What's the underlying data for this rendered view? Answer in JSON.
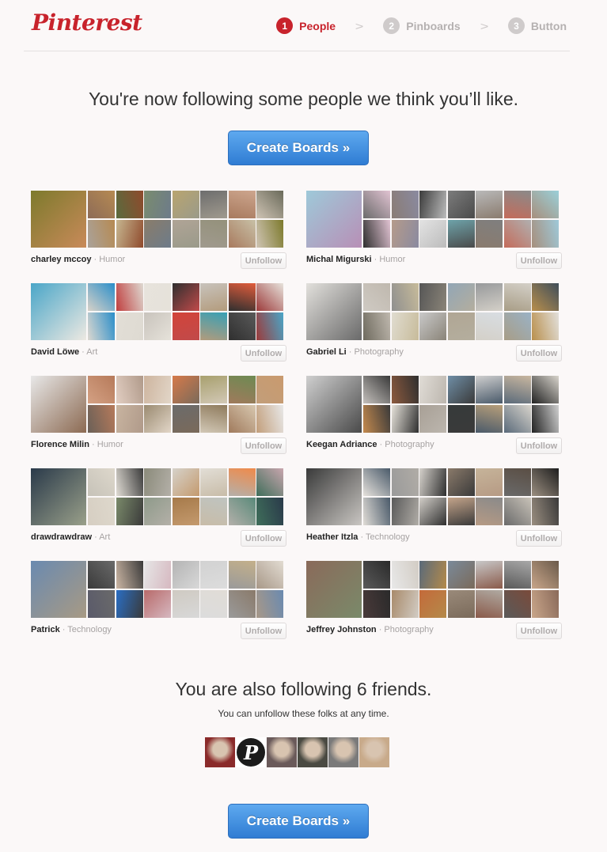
{
  "brand": "Pinterest",
  "steps": [
    {
      "number": "1",
      "label": "People",
      "active": true
    },
    {
      "number": "2",
      "label": "Pinboards",
      "active": false
    },
    {
      "number": "3",
      "label": "Button",
      "active": false
    }
  ],
  "headline": "You're now following some people we think you’ll like.",
  "create_boards_label": "Create Boards »",
  "unfollow_label": "Unfollow",
  "people": [
    {
      "name": "charley mccoy",
      "category": "Humor",
      "colors": [
        "#7d7a2c",
        "#c98a5a",
        "#8d6b57",
        "#5a6b3e",
        "#7a8c6e",
        "#b9a56f",
        "#6d6d6d",
        "#cda68e",
        "#6a6a5a",
        "#b68a52",
        "#8f4a2c",
        "#6d7b8a",
        "#9a9a8a",
        "#a09a8e",
        "#a87a5e",
        "#cfc4b4",
        "#aaa29a",
        "#c6b690",
        "#8a7d6a",
        "#b0a496",
        "#94917b",
        "#c8c1a7"
      ]
    },
    {
      "name": "Michal Migurski",
      "category": "Humor",
      "colors": [
        "#9ec9d9",
        "#b88fb6",
        "#6b6b6b",
        "#8a7c74",
        "#3c3c3c",
        "#7c7c7c",
        "#b9b9b9",
        "#8a8a8a",
        "#9ad0d9",
        "#e1c3d2",
        "#8a8aa0",
        "#bcbcbc",
        "#4a4a4a",
        "#8a7b6e",
        "#c46b5a",
        "#a78f7c",
        "#2f2f2f",
        "#b59b8a",
        "#e3e3e3",
        "#6ea3aa",
        "#7f7f7f",
        "#b0b0b0"
      ]
    },
    {
      "name": "David Löwe",
      "category": "Art",
      "colors": [
        "#4aa6c8",
        "#ede9e2",
        "#d8d2c8",
        "#c03e3e",
        "#e7e3dc",
        "#2f2f2f",
        "#c8c3bc",
        "#e25d3c",
        "#e7e3dc",
        "#2a8ec9",
        "#dedad2",
        "#e6e2da",
        "#c14a4a",
        "#b39b7c",
        "#2f2f2f",
        "#9c3a3a",
        "#dcd8d0",
        "#e2ded6",
        "#c8c3bc",
        "#d2443a",
        "#37a0b5",
        "#5a5a5a"
      ]
    },
    {
      "name": "Gabriel Li",
      "category": "Photography",
      "colors": [
        "#e2e0dc",
        "#6a6a6a",
        "#cfcac3",
        "#8f8f8f",
        "#565656",
        "#92a6b6",
        "#97999b",
        "#d4d0c8",
        "#3f4e5a",
        "#bfb8ae",
        "#c7bb9a",
        "#8a8478",
        "#b4ae9e",
        "#d4d0c8",
        "#a89d86",
        "#b98f4c",
        "#6e6a5e",
        "#e0dcd0",
        "#c9c9c9",
        "#b0a694",
        "#d8dde2",
        "#9ab2c6"
      ]
    },
    {
      "name": "Florence Milin",
      "category": "Humor",
      "colors": [
        "#e8e8e8",
        "#8c6a52",
        "#d4a184",
        "#e2cec2",
        "#cdb49e",
        "#d67a4a",
        "#a8a06e",
        "#6d8a52",
        "#c99a6e",
        "#b67a5a",
        "#b09a8a",
        "#e2d6c8",
        "#7a6a5a",
        "#d2c8b6",
        "#a07a5c",
        "#c29e7a",
        "#6a6058",
        "#c8b4a0",
        "#9a8a70",
        "#6b6b6b",
        "#8e7a5c",
        "#d8c8b0"
      ]
    },
    {
      "name": "Keegan Adriance",
      "category": "Photography",
      "colors": [
        "#cfcfcf",
        "#4a4a4a",
        "#c4c0bc",
        "#8c5a3e",
        "#e0dcd6",
        "#6f8ea6",
        "#cfcfcf",
        "#c9b7a0",
        "#d8d4cc",
        "#3a3a3a",
        "#2f2f2f",
        "#bcb6ae",
        "#3a3a3a",
        "#4a5a6a",
        "#5a6a7a",
        "#222222",
        "#c48a4e",
        "#e6e2da",
        "#a8a096",
        "#363a3a",
        "#b89f7a",
        "#d8d4cc"
      ]
    },
    {
      "name": "drawdrawdraw",
      "category": "Art",
      "colors": [
        "#2a3a4a",
        "#9aa08a",
        "#c6c2b8",
        "#e0dcd4",
        "#8a8a7a",
        "#d6d2ca",
        "#e2ded6",
        "#f08a4a",
        "#c9a6ae",
        "#ded8cc",
        "#3a3a3a",
        "#b4b0a8",
        "#c49a6e",
        "#c8bca8",
        "#b4b0aa",
        "#3f6e5a",
        "#d6cec2",
        "#7a8a6a",
        "#8e9a8a",
        "#a67a4a",
        "#bfc4c0",
        "#5a8a7a"
      ]
    },
    {
      "name": "Heather Itzla",
      "category": "Technology",
      "colors": [
        "#3a3a3a",
        "#c9c6c2",
        "#e6e2dc",
        "#9a9a9a",
        "#d6d2cc",
        "#8a7a6a",
        "#c6b49a",
        "#5a4e44",
        "#1e1e1e",
        "#4a5a6a",
        "#b0aca6",
        "#2f2f2f",
        "#3a3a3a",
        "#b69a84",
        "#6a6a6a",
        "#9a8e80",
        "#e0dcd6",
        "#5a5a5a",
        "#d2cec8",
        "#c4a48a",
        "#8a8a8a",
        "#c8c2b8"
      ]
    },
    {
      "name": "Patrick",
      "category": "Technology",
      "colors": [
        "#6a8ab0",
        "#a89a84",
        "#3a3a3a",
        "#cbb6a4",
        "#e6e6e6",
        "#b4b4b4",
        "#d2d2d2",
        "#c4b08a",
        "#e2dcd2",
        "#6a6a6a",
        "#3a3a3a",
        "#d6b8c0",
        "#d8d8d8",
        "#dcdcdc",
        "#9a9a9a",
        "#a89888",
        "#5a5a6a",
        "#2a6ec4",
        "#b86a6a",
        "#cfcac2",
        "#e0dcd6",
        "#8a7a6a"
      ]
    },
    {
      "name": "Jeffrey Johnston",
      "category": "Photography",
      "colors": [
        "#8a6a5a",
        "#7a8a6a",
        "#5a5a5a",
        "#e8e8e8",
        "#5a6a7a",
        "#7a8a9a",
        "#c8c8c8",
        "#a8a8a8",
        "#6a5a4a",
        "#2a2a2a",
        "#d2ccc4",
        "#b48a4a",
        "#7a6a5a",
        "#8a5a4a",
        "#5a5a5a",
        "#c9a68a",
        "#4a3a3a",
        "#a88a6a",
        "#c46a3a",
        "#9a8a7a",
        "#b0aaa2",
        "#7a4a3a"
      ]
    }
  ],
  "friends_title": "You are also following 6 friends.",
  "friends_subtitle": "You can unfollow these folks at any time.",
  "friends": [
    {
      "type": "photo",
      "color": "#8a2a2a"
    },
    {
      "type": "pinterest-logo",
      "letter": "P"
    },
    {
      "type": "photo",
      "color": "#6a5a5a"
    },
    {
      "type": "photo",
      "color": "#4a4a42"
    },
    {
      "type": "photo",
      "color": "#7a7a7a"
    },
    {
      "type": "photo",
      "color": "#c8aa8a"
    }
  ],
  "accent_color": "#c8232c",
  "button_color": "#2f7cd3"
}
